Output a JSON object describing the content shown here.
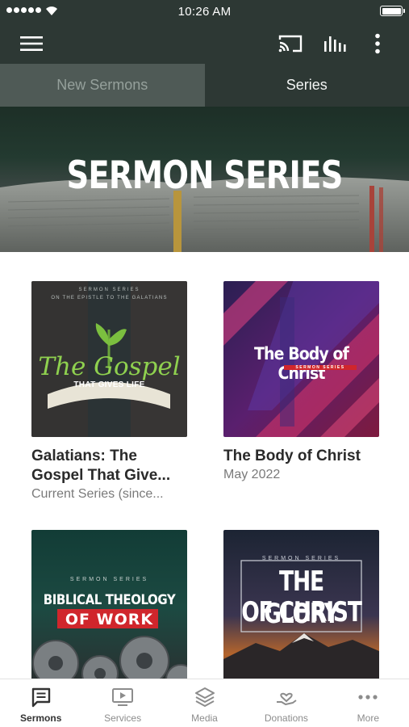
{
  "status_bar": {
    "time": "10:26 AM"
  },
  "app_bar": {
    "icons": [
      "menu-icon",
      "cast-icon",
      "audio-bars-icon",
      "more-vertical-icon"
    ]
  },
  "tabs": [
    {
      "label": "New Sermons",
      "selected": false
    },
    {
      "label": "Series",
      "selected": true
    }
  ],
  "hero": {
    "title": "SERMON SERIES"
  },
  "series": [
    {
      "title": "Galatians: The Gospel That Give...",
      "subtitle": "Current Series (since...",
      "artwork": {
        "top_line": "SERMON SERIES",
        "second_line": "ON THE EPISTLE TO THE GALATIANS",
        "main": "The Gospel",
        "sub": "THAT GIVES LIFE"
      }
    },
    {
      "title": "The Body of Christ",
      "subtitle": "May 2022",
      "artwork": {
        "main": "The Body of Christ",
        "sub": "SERMON SERIES"
      }
    },
    {
      "title": "",
      "subtitle": "",
      "artwork": {
        "top_line": "SERMON SERIES",
        "main": "BIBLICAL THEOLOGY",
        "sub": "OF WORK"
      }
    },
    {
      "title": "",
      "subtitle": "",
      "artwork": {
        "top_line": "SERMON SERIES",
        "main_line1": "THE GLORY",
        "main_line2": "OF CHRIST"
      }
    }
  ],
  "bottom_nav": [
    {
      "label": "Sermons",
      "icon": "sermons-icon",
      "active": true
    },
    {
      "label": "Services",
      "icon": "services-icon",
      "active": false
    },
    {
      "label": "Media",
      "icon": "media-icon",
      "active": false
    },
    {
      "label": "Donations",
      "icon": "donations-icon",
      "active": false
    },
    {
      "label": "More",
      "icon": "more-horizontal-icon",
      "active": false
    }
  ],
  "colors": {
    "header": "#2d3834",
    "tab_inactive": "#4f5a56",
    "accent_red": "#d0262c"
  }
}
